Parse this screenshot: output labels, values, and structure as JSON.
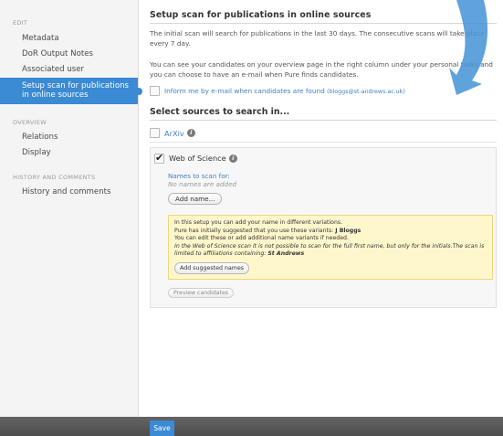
{
  "sidebar": {
    "sections": [
      {
        "heading": "EDIT",
        "items": [
          {
            "label": "Metadata"
          },
          {
            "label": "DoR Output Notes"
          },
          {
            "label": "Associated user"
          },
          {
            "label": "Setup scan for publications in online sources",
            "active": true
          }
        ]
      },
      {
        "heading": "OVERVIEW",
        "items": [
          {
            "label": "Relations"
          },
          {
            "label": "Display"
          }
        ]
      },
      {
        "heading": "HISTORY AND COMMENTS",
        "items": [
          {
            "label": "History and comments"
          }
        ]
      }
    ]
  },
  "main": {
    "title": "Setup scan for publications in online sources",
    "intro": "The initial scan will search for publications in the last 30 days. The consecutive scans will take place every 7 day.",
    "info": "You can see your candidates on your overview page in the right column under your personal tasks and you can choose to have an e-mail when Pure finds candidates.",
    "email_checkbox": {
      "label": "Inform me by e-mail when candidates are found",
      "email": "(bloggs@st-andrews.ac.uk)",
      "checked": false
    },
    "sources_title": "Select sources to search in...",
    "sources": {
      "arxiv": {
        "label": "ArXiv",
        "checked": false
      },
      "wos": {
        "label": "Web of Science",
        "checked": true,
        "names_label": "Names to scan for:",
        "names_empty": "No names are added",
        "add_name_label": "Add name...",
        "note": {
          "line1": "In this setup you can add your name in different variations.",
          "line2_prefix": "Pure has initially suggested that you use these variants:",
          "suggested_name": "J Bloggs",
          "line3": "You can edit these or add additional name variants if needed.",
          "line4": "In the Web of Science scan it is not possible to scan for the full first name, but only for the initials.The scan is limited to affiliations containing:",
          "affiliation": "St Andrews",
          "add_suggested_label": "Add suggested names"
        },
        "preview_label": "Preview candidates"
      }
    }
  },
  "footer": {
    "save_label": "Save"
  },
  "colors": {
    "accent": "#3a8ad4",
    "link": "#3f7ec0",
    "note_bg": "#fff7cc"
  }
}
